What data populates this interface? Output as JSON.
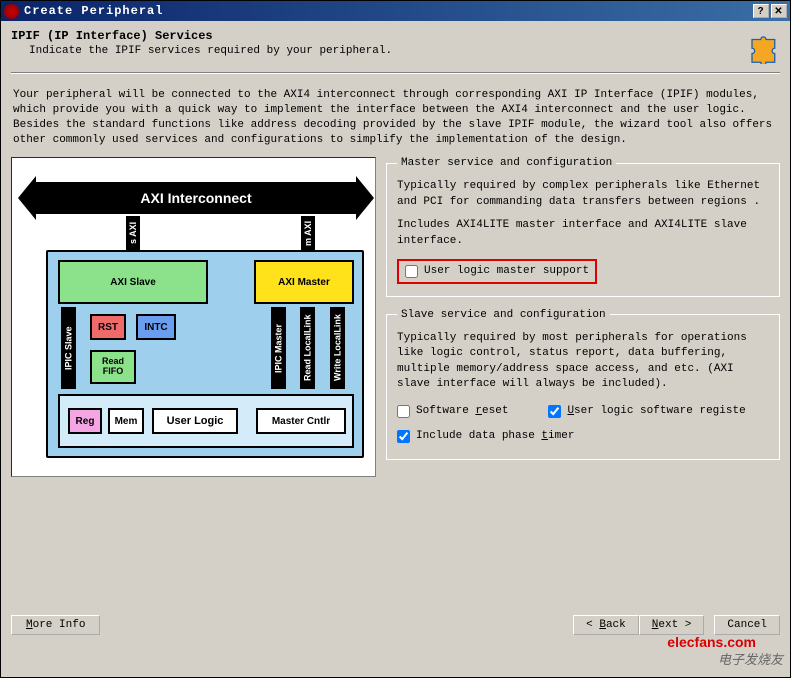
{
  "window": {
    "title": "Create Peripheral"
  },
  "header": {
    "title": "IPIF (IP Interface) Services",
    "subtitle": "Indicate the IPIF services required by your peripheral."
  },
  "intro": "Your peripheral will be connected to the AXI4 interconnect through corresponding AXI IP Interface (IPIF) modules, which provide you with a quick way to implement the interface between the AXI4 interconnect and the user logic. Besides the standard functions like address decoding provided by the slave IPIF module, the wizard tool also offers other commonly used services and configurations to simplify the implementation of the design.",
  "diagram": {
    "interconnect": "AXI Interconnect",
    "s_axi": "s AXI",
    "m_axi": "m AXI",
    "axi_slave": "AXI Slave",
    "axi_master": "AXI Master",
    "ipic_slave": "IPIC Slave",
    "ipic_master": "IPIC Master",
    "read_ll": "Read LocalLink",
    "write_ll": "Write LocalLink",
    "rst": "RST",
    "intc": "INTC",
    "read_fifo": "Read FIFO",
    "reg": "Reg",
    "mem": "Mem",
    "user_logic": "User Logic",
    "master_cntlr": "Master Cntlr"
  },
  "master_group": {
    "legend": "Master service and configuration",
    "p1": "Typically required by complex peripherals like Ethernet and PCI for commanding data transfers between regions .",
    "p2": "Includes AXI4LITE master interface and AXI4LITE slave interface.",
    "checkbox_label": "User logic master support",
    "checkbox_hotkey": "t",
    "checked": false
  },
  "slave_group": {
    "legend": "Slave service and configuration",
    "p1": "Typically required by most peripherals for operations like logic control, status report, data buffering, multiple memory/address space access, and etc. (AXI slave interface will always be included).",
    "sw_reset": {
      "label": "Software reset",
      "hot": "r",
      "checked": false
    },
    "user_reg": {
      "label": "User logic software registe",
      "hot": "U",
      "checked": true
    },
    "phase_timer": {
      "label": "Include data phase timer",
      "hot": "t",
      "checked": true
    }
  },
  "footer": {
    "more_info": "More Info",
    "more_info_hot": "M",
    "back": "< Back",
    "back_hot": "B",
    "next": "Next >",
    "next_hot": "N",
    "cancel": "Cancel"
  },
  "watermark": "elecfans.com",
  "watermark2": "电子发烧友"
}
